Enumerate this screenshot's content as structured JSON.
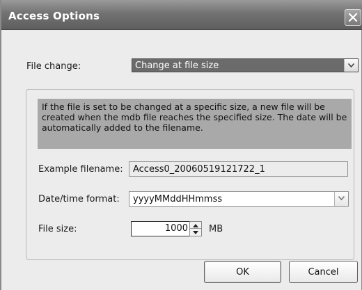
{
  "window": {
    "title": "Access Options"
  },
  "file_change": {
    "label": "File change:",
    "selected": "Change at file size"
  },
  "info_text": "If the file is set to be changed at a specific size, a new file will be created when the mdb file reaches the specified size. The date will be automatically added to the filename.",
  "example_filename": {
    "label": "Example filename:",
    "value": "Access0_20060519121722_1"
  },
  "date_time_format": {
    "label": "Date/time format:",
    "selected": "yyyyMMddHHmmss"
  },
  "file_size": {
    "label": "File size:",
    "value": "1000",
    "unit": "MB"
  },
  "buttons": {
    "ok": "OK",
    "cancel": "Cancel"
  },
  "icons": {
    "close": "close-icon",
    "dropdown": "chevron-down-icon",
    "spin_up": "spin-up-icon",
    "spin_down": "spin-down-icon"
  }
}
